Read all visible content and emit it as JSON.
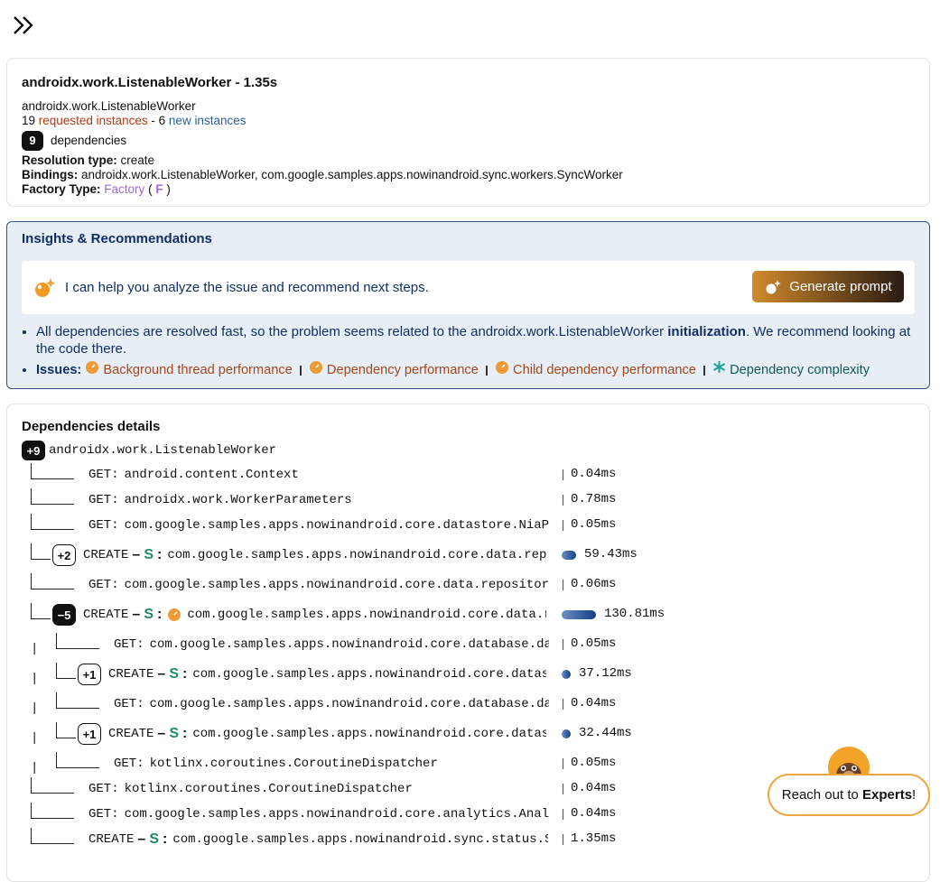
{
  "toggle": {
    "icon": "double-chevron-right-icon"
  },
  "info": {
    "title": "androidx.work.ListenableWorker - 1.35s",
    "class_name": "androidx.work.ListenableWorker",
    "requested_count": "19",
    "requested_label": "requested instances",
    "new_sep": "- 6",
    "new_label": "new instances",
    "dep_count": "9",
    "dep_label": "dependencies",
    "resolution_label": "Resolution type:",
    "resolution_value": "create",
    "bindings_label": "Bindings:",
    "bindings_value": "androidx.work.ListenableWorker, com.google.samples.apps.nowinandroid.sync.workers.SyncWorker",
    "factory_label": "Factory Type:",
    "factory_value": "Factory",
    "factory_letter": "F"
  },
  "insights": {
    "title": "Insights & Recommendations",
    "assist_text": "I can help you analyze the issue and recommend next steps.",
    "generate_label": "Generate prompt",
    "rec_pre": "All dependencies are resolved fast, so the problem seems related to the androidx.work.ListenableWorker ",
    "rec_bold": "initialization",
    "rec_post": ". We recommend looking at the code there.",
    "issues_label": "Issues:",
    "issues": [
      {
        "label": "Background thread performance",
        "icon": "performance-gauge-icon"
      },
      {
        "label": "Dependency performance",
        "icon": "performance-gauge-icon"
      },
      {
        "label": "Child dependency performance",
        "icon": "performance-gauge-icon"
      },
      {
        "label": "Dependency complexity",
        "icon": "complexity-asterisk-icon"
      }
    ],
    "colors": {
      "accent": "#2d5583",
      "issue": "#a6461c",
      "complexity": "#0e5a57"
    }
  },
  "deps": {
    "title": "Dependencies details",
    "root_badge": "+9",
    "root_name": "androidx.work.ListenableWorker",
    "rows": [
      {
        "op": "GET:",
        "name": "android.content.Context",
        "time": "0.04ms"
      },
      {
        "op": "GET:",
        "name": "androidx.work.WorkerParameters",
        "time": "0.78ms"
      },
      {
        "op": "GET:",
        "name": "com.google.samples.apps.nowinandroid.core.datastore.NiaPreferencesDataSource",
        "time": "0.05ms"
      },
      {
        "op": "CREATE",
        "badge": "+2",
        "scope": "S",
        "name": "com.google.samples.apps.nowinandroid.core.data.repository.OfflineFirstTopicsRepository",
        "time": "59.43ms"
      },
      {
        "op": "GET:",
        "name": "com.google.samples.apps.nowinandroid.core.data.repository.NewsRepository",
        "time": "0.06ms"
      },
      {
        "op": "CREATE",
        "badge": "−5",
        "scope": "S",
        "name": "com.google.samples.apps.nowinandroid.core.data.repository.OfflineFirstNewsRepository",
        "time": "130.81ms"
      },
      {
        "op": "GET:",
        "name": "com.google.samples.apps.nowinandroid.core.database.dao.NewsResourceDao",
        "time": "0.05ms"
      },
      {
        "op": "CREATE",
        "badge": "+1",
        "scope": "S",
        "name": "com.google.samples.apps.nowinandroid.core.datastore.NiaPreferencesDataSource",
        "time": "37.12ms"
      },
      {
        "op": "GET:",
        "name": "com.google.samples.apps.nowinandroid.core.database.dao.TopicDao",
        "time": "0.04ms"
      },
      {
        "op": "CREATE",
        "badge": "+1",
        "scope": "S",
        "name": "com.google.samples.apps.nowinandroid.core.datastore.ChangeListVersions",
        "time": "32.44ms"
      },
      {
        "op": "GET:",
        "name": "kotlinx.coroutines.CoroutineDispatcher",
        "time": "0.05ms"
      },
      {
        "op": "GET:",
        "name": "kotlinx.coroutines.CoroutineDispatcher",
        "time": "0.04ms"
      },
      {
        "op": "GET:",
        "name": "com.google.samples.apps.nowinandroid.core.analytics.AnalyticsHelper",
        "time": "0.04ms"
      },
      {
        "op": "CREATE",
        "scope": "S",
        "name": "com.google.samples.apps.nowinandroid.sync.status.StubSyncSubscriber",
        "time": "1.35ms"
      }
    ],
    "dash": "–",
    "colon": ":",
    "pipe": "|"
  },
  "experts": {
    "pre": "Reach out to ",
    "bold": "Experts",
    "post": "!"
  }
}
